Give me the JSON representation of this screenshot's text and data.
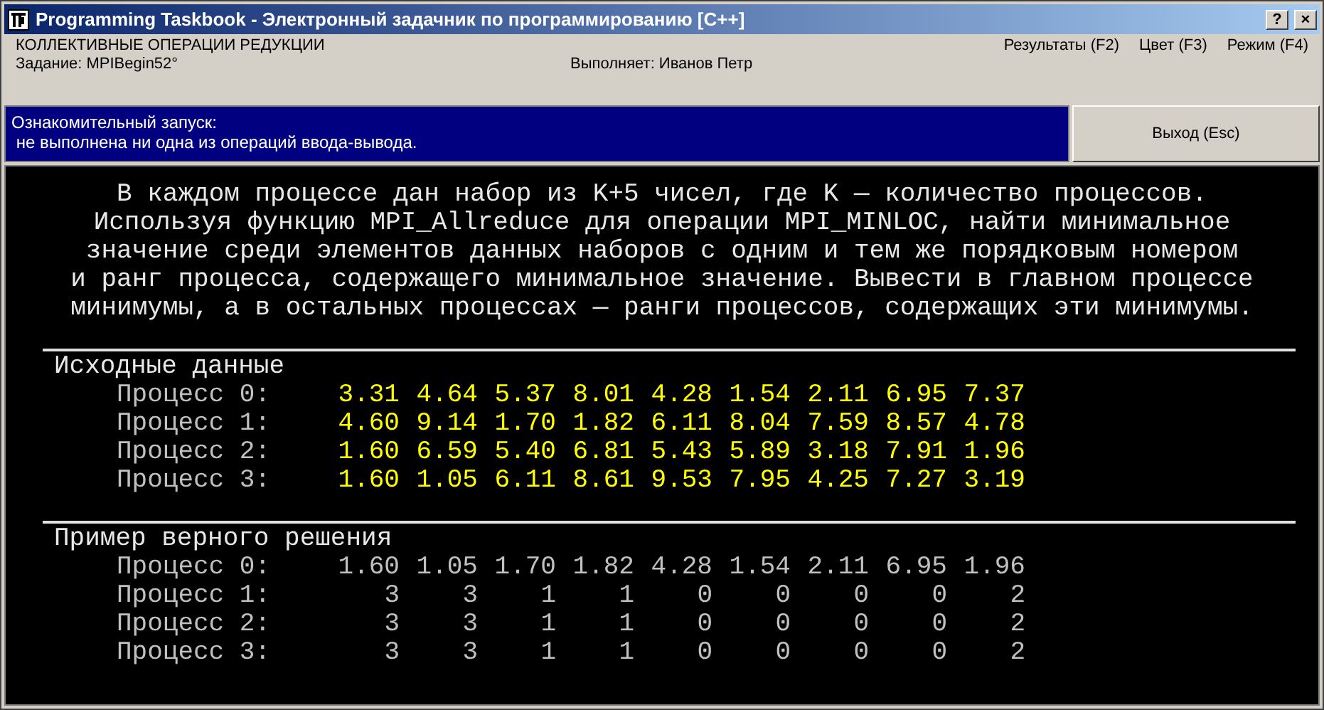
{
  "window": {
    "title": "Programming Taskbook - Электронный задачник по программированию [C++]",
    "buttons": [
      "?",
      "×"
    ]
  },
  "header": {
    "topic": "КОЛЛЕКТИВНЫЕ ОПЕРАЦИИ РЕДУКЦИИ",
    "task": "Задание: MPIBegin52°",
    "performer": "Выполняет: Иванов Петр",
    "menu": [
      "Результаты (F2)",
      "Цвет (F3)",
      "Режим (F4)"
    ]
  },
  "status": {
    "lines": [
      "Ознакомительный запуск:",
      " не выполнена ни одна из операций ввода-вывода."
    ],
    "exit_button": "Выход (Esc)"
  },
  "description": [
    "В каждом процессе дан набор из K+5 чисел, где K — количество процессов.",
    "Используя функцию MPI_Allreduce для операции MPI_MINLOC, найти минимальное",
    "значение среди элементов данных наборов с одним и тем же порядковым номером",
    "и ранг процесса, содержащего минимальное значение. Вывести в главном процессе",
    "минимумы, а в остальных процессах — ранги процессов, содержащих эти минимумы."
  ],
  "sections": [
    {
      "title": "Исходные данные",
      "kind": "input",
      "rows": [
        {
          "label": "Процесс 0:",
          "values": [
            "3.31",
            "4.64",
            "5.37",
            "8.01",
            "4.28",
            "1.54",
            "2.11",
            "6.95",
            "7.37"
          ]
        },
        {
          "label": "Процесс 1:",
          "values": [
            "4.60",
            "9.14",
            "1.70",
            "1.82",
            "6.11",
            "8.04",
            "7.59",
            "8.57",
            "4.78"
          ]
        },
        {
          "label": "Процесс 2:",
          "values": [
            "1.60",
            "6.59",
            "5.40",
            "6.81",
            "5.43",
            "5.89",
            "3.18",
            "7.91",
            "1.96"
          ]
        },
        {
          "label": "Процесс 3:",
          "values": [
            "1.60",
            "1.05",
            "6.11",
            "8.61",
            "9.53",
            "7.95",
            "4.25",
            "7.27",
            "3.19"
          ]
        }
      ]
    },
    {
      "title": "Пример верного решения",
      "kind": "output",
      "rows": [
        {
          "label": "Процесс 0:",
          "values": [
            "1.60",
            "1.05",
            "1.70",
            "1.82",
            "4.28",
            "1.54",
            "2.11",
            "6.95",
            "1.96"
          ]
        },
        {
          "label": "Процесс 1:",
          "values": [
            "3",
            "3",
            "1",
            "1",
            "0",
            "0",
            "0",
            "0",
            "2"
          ]
        },
        {
          "label": "Процесс 2:",
          "values": [
            "3",
            "3",
            "1",
            "1",
            "0",
            "0",
            "0",
            "0",
            "2"
          ]
        },
        {
          "label": "Процесс 3:",
          "values": [
            "3",
            "3",
            "1",
            "1",
            "0",
            "0",
            "0",
            "0",
            "2"
          ]
        }
      ]
    }
  ]
}
